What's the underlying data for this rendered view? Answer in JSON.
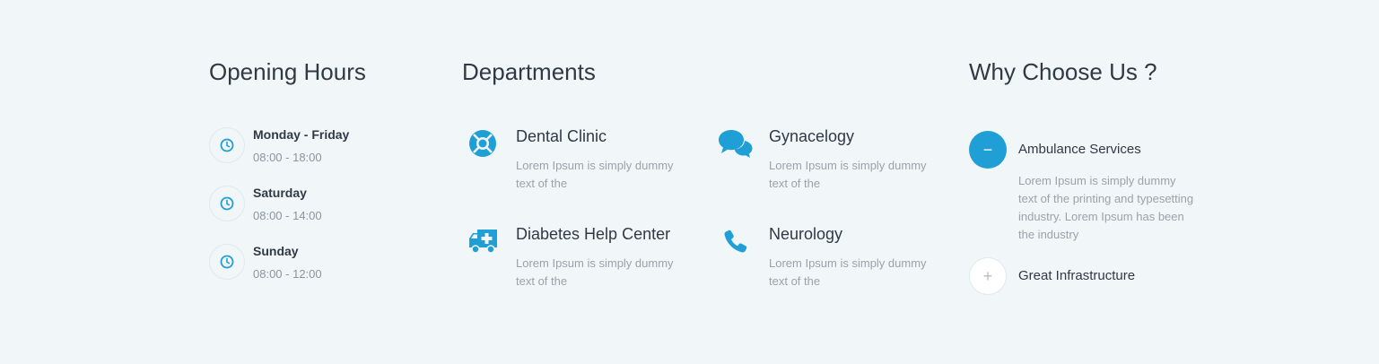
{
  "opening_hours": {
    "heading": "Opening Hours",
    "items": [
      {
        "day": "Monday - Friday",
        "time": "08:00 - 18:00"
      },
      {
        "day": "Saturday",
        "time": "08:00 - 14:00"
      },
      {
        "day": "Sunday",
        "time": "08:00 - 12:00"
      }
    ]
  },
  "departments": {
    "heading": "Departments",
    "items": [
      {
        "title": "Dental Clinic",
        "desc": "Lorem Ipsum is simply dummy text of the",
        "icon": "lifebuoy-icon"
      },
      {
        "title": "Gynacelogy",
        "desc": "Lorem Ipsum is simply dummy text of the",
        "icon": "chat-bubbles-icon"
      },
      {
        "title": "Diabetes Help Center",
        "desc": "Lorem Ipsum is simply dummy text of the",
        "icon": "ambulance-icon"
      },
      {
        "title": "Neurology",
        "desc": "Lorem Ipsum is simply dummy text of the",
        "icon": "phone-icon"
      }
    ]
  },
  "why_choose_us": {
    "heading": "Why Choose Us ?",
    "items": [
      {
        "title": "Ambulance Services",
        "desc": "Lorem Ipsum is simply dummy text of the printing and typesetting industry. Lorem Ipsum has been the industry",
        "toggle": "−",
        "expanded": true
      },
      {
        "title": "Great Infrastructure",
        "toggle": "+",
        "expanded": false
      }
    ]
  },
  "colors": {
    "accent": "#1f9fd6",
    "background": "#f1f6f9",
    "heading": "#2f3a44",
    "muted": "#9aa3aa"
  }
}
